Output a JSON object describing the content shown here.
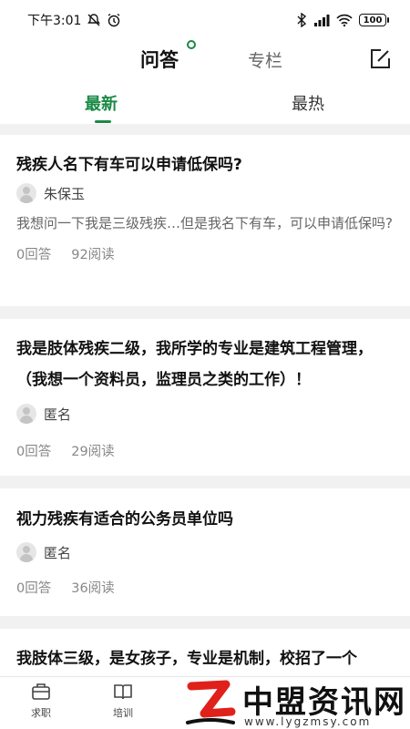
{
  "status_bar": {
    "time": "下午3:01",
    "battery": "100"
  },
  "top_nav": {
    "tab_qa": "问答",
    "tab_column": "专栏"
  },
  "sub_tabs": {
    "latest": "最新",
    "hottest": "最热"
  },
  "posts": [
    {
      "title": "残疾人名下有车可以申请低保吗?",
      "author": "朱保玉",
      "body": "我想问一下我是三级残疾…但是我名下有车，可以申请低保吗?",
      "answers": "0回答",
      "reads": "92阅读"
    },
    {
      "title": "我是肢体残疾二级，我所学的专业是建筑工程管理，（我想一个资料员，监理员之类的工作）！",
      "author": "匿名",
      "body": "",
      "answers": "0回答",
      "reads": "29阅读"
    },
    {
      "title": "视力残疾有适合的公务员单位吗",
      "author": "匿名",
      "body": "",
      "answers": "0回答",
      "reads": "36阅读"
    },
    {
      "title": "我肢体三级，是女孩子，专业是机制，校招了一个",
      "author": "",
      "body": "",
      "answers": "",
      "reads": ""
    }
  ],
  "bottom_nav": {
    "jobs": "求职",
    "training": "培训"
  },
  "watermark": {
    "brand": "中盟资讯网",
    "url": "www.lygzmsy.com"
  },
  "colors": {
    "accent": "#1a8a45"
  }
}
